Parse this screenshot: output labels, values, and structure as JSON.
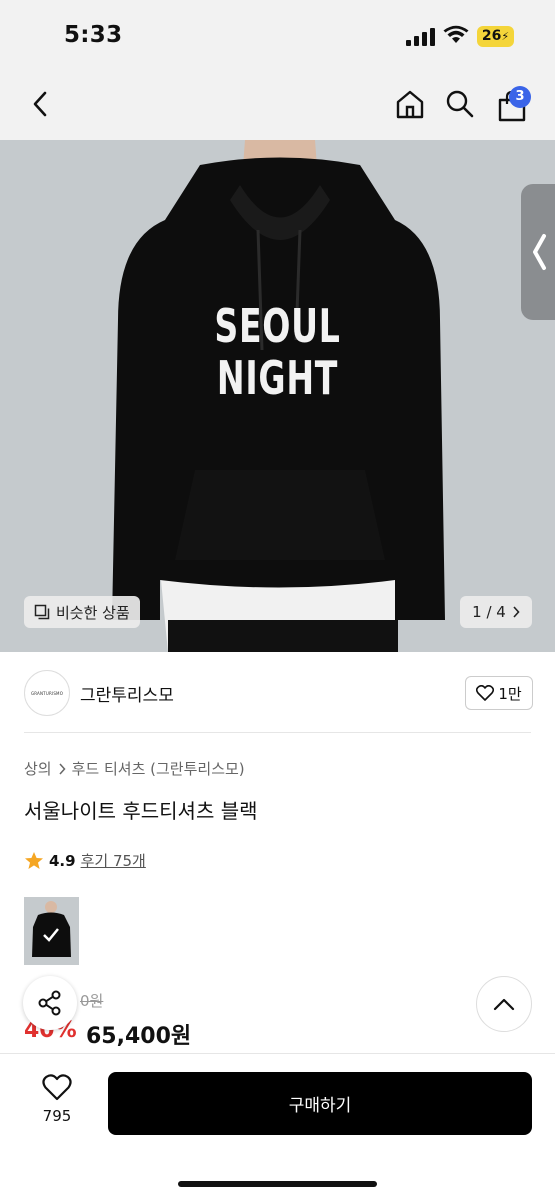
{
  "status_bar": {
    "time": "5:33",
    "battery": "26"
  },
  "nav": {
    "cart_count": "3"
  },
  "product_image": {
    "print_line1": "SEOUL",
    "print_line2": "NIGHT"
  },
  "image_overlay": {
    "similar_label": "비슷한 상품",
    "pager": "1 / 4"
  },
  "brand": {
    "logo_text": "GRANTURISMO",
    "name": "그란투리스모",
    "likes": "1만"
  },
  "breadcrumb": {
    "category": "상의",
    "subcategory": "후드 티셔츠 (그란투리스모)"
  },
  "product": {
    "title": "서울나이트 후드티셔츠 블랙",
    "rating": "4.9",
    "reviews": "후기 75개",
    "original_price": "0원",
    "discount": "40%",
    "sale_price": "65,400원"
  },
  "bottom_bar": {
    "wish_count": "795",
    "buy_label": "구매하기"
  },
  "colors": {
    "accent_blue": "#3a64e8",
    "discount_red": "#e0312f",
    "star": "#f5a623"
  },
  "icons": [
    "back-icon",
    "home-icon",
    "search-icon",
    "shopping-bag-icon",
    "similar-icon",
    "chevron-right-icon",
    "heart-icon",
    "star-icon",
    "share-icon",
    "chevron-up-icon"
  ]
}
